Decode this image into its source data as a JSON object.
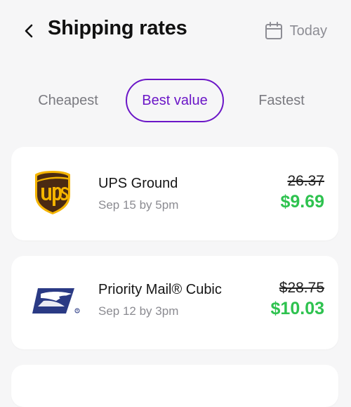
{
  "header": {
    "title": "Shipping rates",
    "date_label": "Today",
    "back_icon": "chevron-left-icon",
    "calendar_icon": "calendar-icon"
  },
  "tabs": [
    {
      "label": "Cheapest",
      "selected": false
    },
    {
      "label": "Best value",
      "selected": true
    },
    {
      "label": "Fastest",
      "selected": false
    }
  ],
  "rates": [
    {
      "carrier": "UPS",
      "logo": "ups-logo",
      "service": "UPS Ground",
      "eta": "Sep 15 by 5pm",
      "original_price": "26.37",
      "price": "$9.69"
    },
    {
      "carrier": "USPS",
      "logo": "usps-logo",
      "service": "Priority Mail® Cubic",
      "eta": "Sep 12 by 3pm",
      "original_price": "$28.75",
      "price": "$10.03"
    }
  ],
  "colors": {
    "accent": "#6b16c7",
    "price_green": "#2ec24f",
    "background": "#f6f6f7",
    "muted_text": "#8b8b91"
  }
}
